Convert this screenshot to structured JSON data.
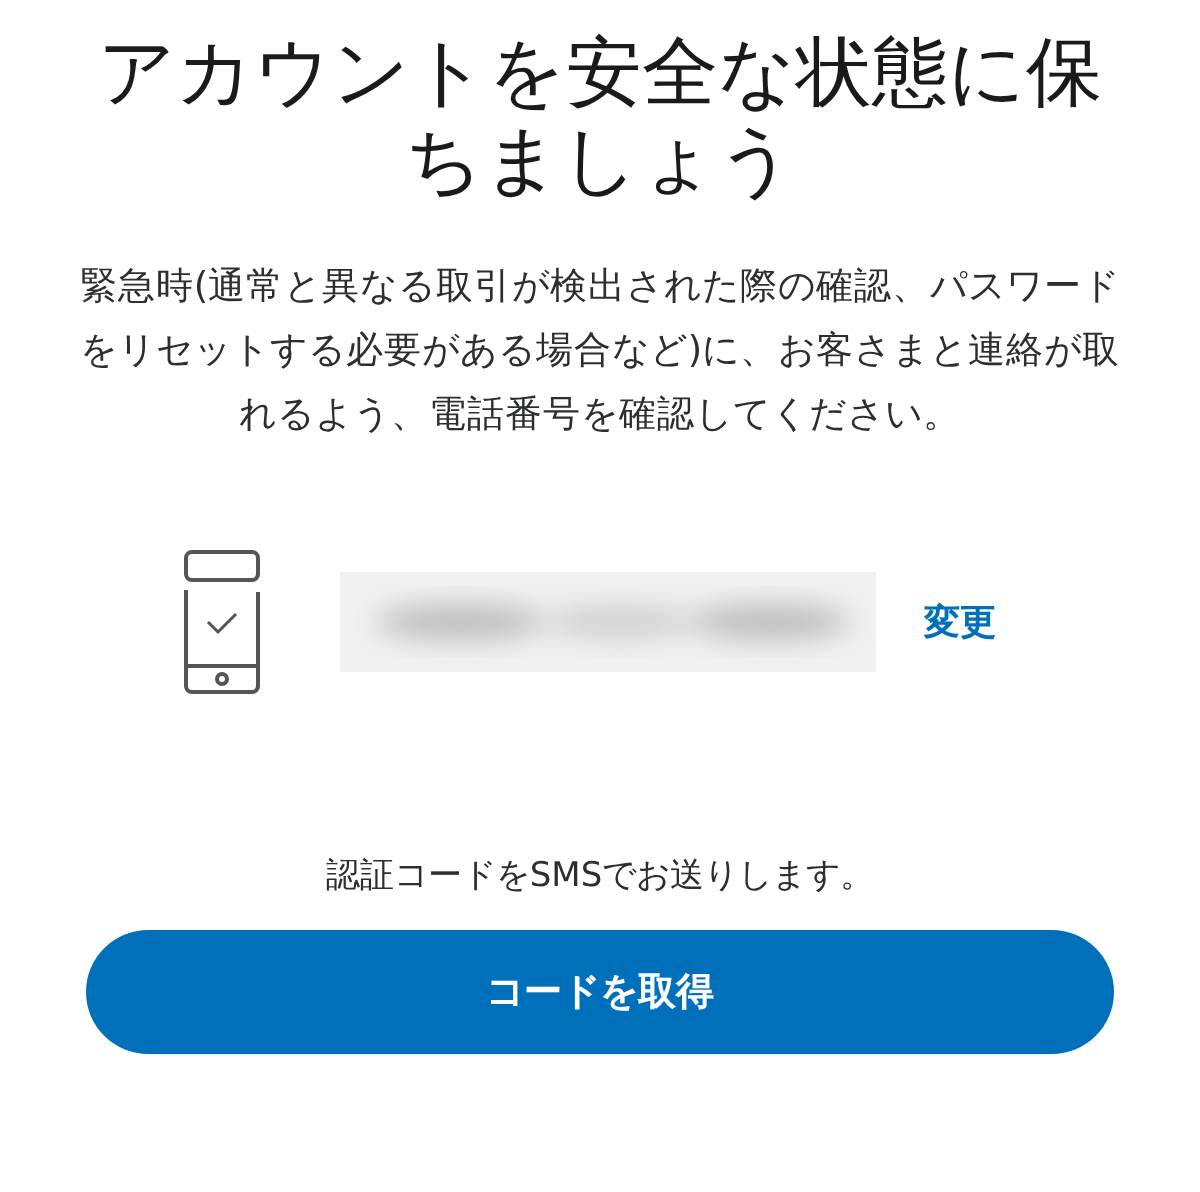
{
  "title": "アカウントを安全な状態に保ちましょう",
  "description": "緊急時(通常と異なる取引が検出された際の確認、パスワードをリセットする必要がある場合など)に、お客さまと連絡が取れるよう、電話番号を確認してください。",
  "phone": {
    "number_display": {
      "kind": "blurred"
    },
    "change_link": "変更"
  },
  "sms_note": "認証コードをSMSでお送りします。",
  "button": "コードを取得"
}
